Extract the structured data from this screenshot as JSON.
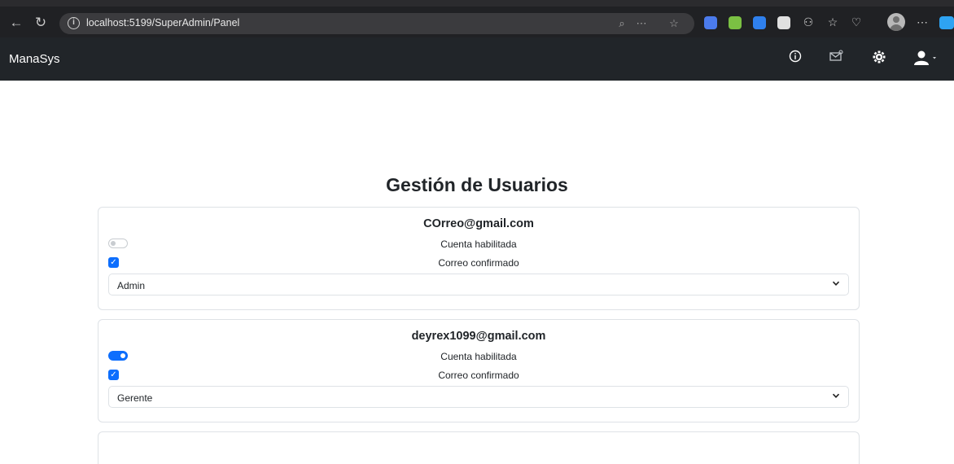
{
  "browser": {
    "url": "localhost:5199/SuperAdmin/Panel"
  },
  "navbar": {
    "brand": "ManaSys"
  },
  "page": {
    "title": "Gestión de Usuarios"
  },
  "users": [
    {
      "email": "COrreo@gmail.com",
      "account_enabled_label": "Cuenta habilitada",
      "account_enabled": false,
      "email_confirmed_label": "Correo confirmado",
      "email_confirmed": true,
      "role": "Admin"
    },
    {
      "email": "deyrex1099@gmail.com",
      "account_enabled_label": "Cuenta habilitada",
      "account_enabled": true,
      "email_confirmed_label": "Correo confirmado",
      "email_confirmed": true,
      "role": "Gerente"
    }
  ],
  "colors": {
    "primary": "#0d6efd",
    "navbar": "#212529",
    "browser_bar": "#202124"
  }
}
